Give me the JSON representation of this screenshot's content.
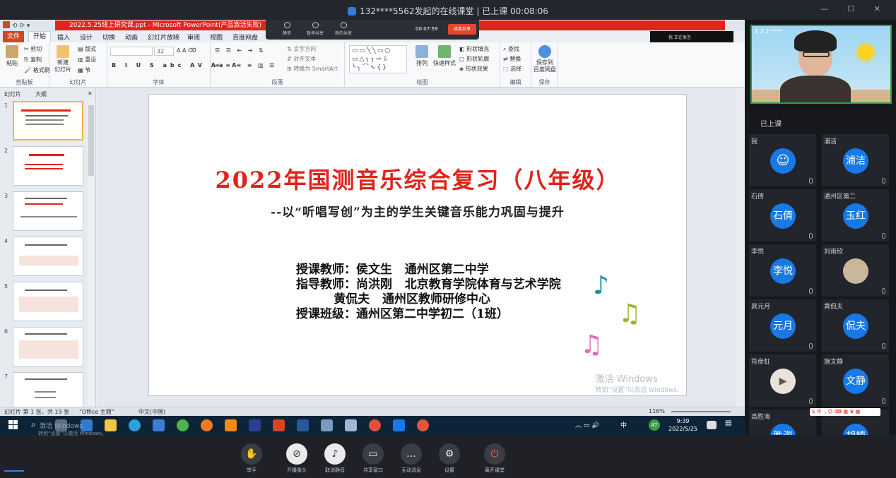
{
  "meeting": {
    "title": "132****5562发起的在线课堂 | 已上课 00:08:06",
    "window_controls": "— ☐ ✕"
  },
  "ppt": {
    "window_title": "2022.5.25线上研究课.ppt - Microsoft PowerPoint(产品激活失败)",
    "mini_bar": {
      "mute": "静音",
      "share": "暂停共享",
      "new_share": "新的共享",
      "duration": "00:07:59",
      "stop": "结束共享"
    },
    "speaking": "我  正在发言",
    "tabs": [
      "文件",
      "开始",
      "插入",
      "设计",
      "切换",
      "动画",
      "幻灯片放映",
      "审阅",
      "视图",
      "百度网盘"
    ],
    "ribbon": {
      "paste": "粘贴",
      "cut": "剪切",
      "copy": "复制",
      "format_painter": "格式刷",
      "clipboard": "剪贴板",
      "new_slide": "新建\n幻灯片",
      "layout": "版式",
      "reset": "重设",
      "section": "节",
      "slides_group": "幻灯片",
      "font_size": "32",
      "font_group": "字体",
      "text_direction": "文字方向",
      "align_text": "对齐文本",
      "smartart": "转换为 SmartArt",
      "paragraph_group": "段落",
      "arrange": "排列",
      "quick_styles": "快速样式",
      "shape_fill": "形状填充",
      "shape_outline": "形状轮廓",
      "shape_effects": "形状效果",
      "drawing_group": "绘图",
      "find": "查找",
      "replace": "替换",
      "select": "选择",
      "editing_group": "编辑",
      "save_baidu": "保存到\n百度网盘",
      "save_group": "保存"
    },
    "panel_tabs": [
      "幻灯片",
      "大纲"
    ],
    "thumbs": [
      "1",
      "2",
      "3",
      "4",
      "5",
      "6",
      "7"
    ],
    "slide": {
      "title": "2022年国测音乐综合复习（八年级）",
      "subtitle": "--以“听唱写创”为主的学生关键音乐能力巩固与提升",
      "info": "授课教师：侯文生   通州区第二中学\n指导教师：尚洪刚   北京教育学院体育与艺术学院\n         黄侃夫   通州区教师研修中心\n授课班级：通州区第二中学初二（1班）",
      "watermark": "激活 Windows",
      "watermark_sub": "转到“设置”以激活 Windows。"
    },
    "status": {
      "slide_count": "幻灯片 第 1 张，共 19 张",
      "theme": "“Office 主题”",
      "language": "中文(中国)",
      "zoom": "116%"
    }
  },
  "taskbar": {
    "time": "9:39",
    "date": "2022/5/25",
    "tray_lang": "中",
    "tray_num": "47"
  },
  "controls": [
    {
      "label": "举手",
      "icon": "✋"
    },
    {
      "label": "开摄像头",
      "icon": "⊘"
    },
    {
      "label": "取消静音",
      "icon": "♪"
    },
    {
      "label": "共享窗口",
      "icon": "▭"
    },
    {
      "label": "互动消息",
      "icon": "…"
    },
    {
      "label": "设置",
      "icon": "⚙"
    },
    {
      "label": "离开课堂",
      "icon": "⏻"
    }
  ],
  "participants_panel": {
    "video_label": "1 3 2 ****",
    "class_status": "已上课",
    "tiles": [
      {
        "name": "我",
        "avatar": ""
      },
      {
        "name": "浦洁",
        "avatar": "浦洁"
      },
      {
        "name": "石倩",
        "avatar": "石倩"
      },
      {
        "name": "通州区第二",
        "avatar": "玉红"
      },
      {
        "name": "李悦",
        "avatar": "李悦"
      },
      {
        "name": "刘雨欣",
        "avatar": ""
      },
      {
        "name": "晁元月",
        "avatar": "元月"
      },
      {
        "name": "黄侃夫",
        "avatar": "侃夫"
      },
      {
        "name": "符彦虹",
        "avatar": ""
      },
      {
        "name": "施文静",
        "avatar": "文静"
      },
      {
        "name": "高胜海",
        "avatar": "胜海"
      },
      {
        "name": "",
        "avatar": "胡楠"
      }
    ],
    "ime_bar": "S 中 ·, ☺ ⌨ ▦ ♛ ▦",
    "watermark": "激活 Windows",
    "watermark_sub": "转到“设置”以激活 Windows。"
  },
  "colors": {
    "accent_blue": "#1778e6",
    "ppt_red": "#e5231d",
    "video_border": "#27a24b"
  }
}
